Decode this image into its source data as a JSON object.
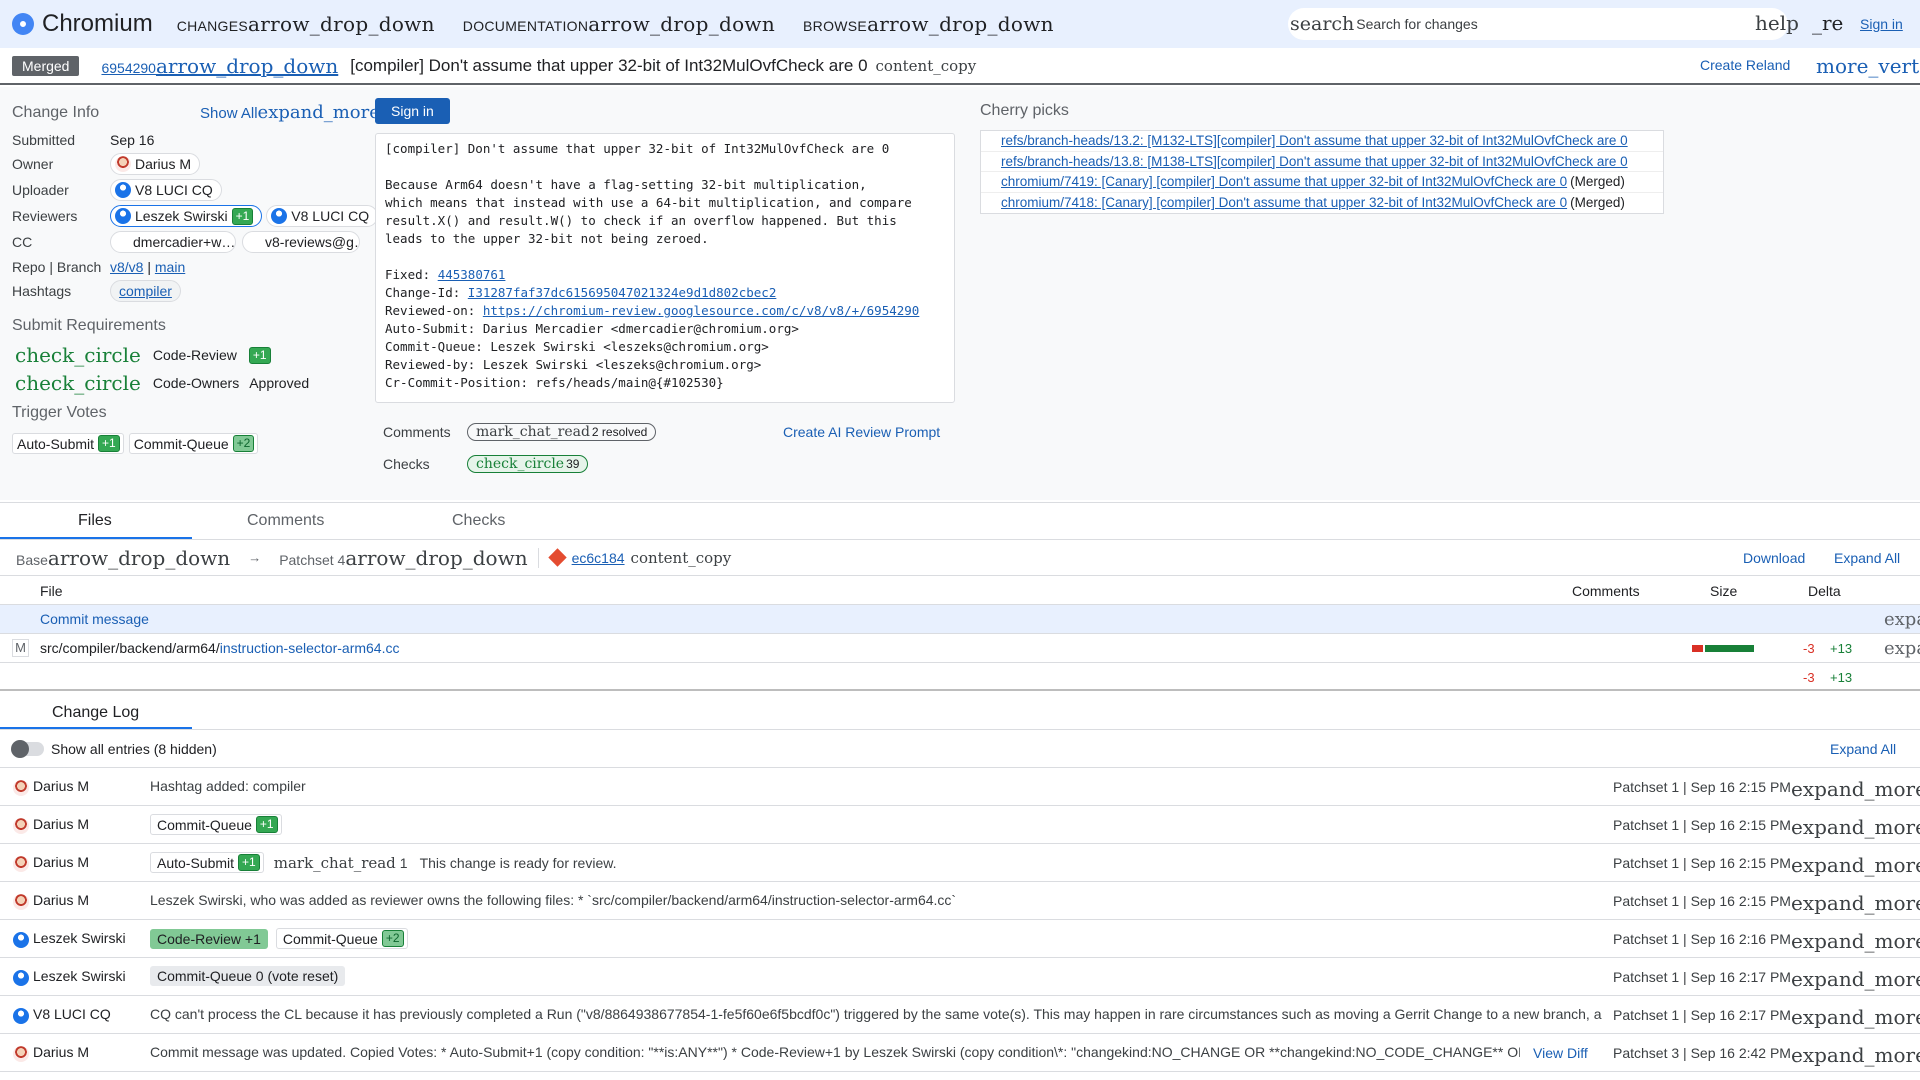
{
  "header": {
    "logo_text": "Chromium",
    "nav": [
      {
        "label": "CHANGES",
        "icon": "arrow_drop_down"
      },
      {
        "label": "DOCUMENTATION",
        "icon": "arrow_drop_down"
      },
      {
        "label": "BROWSE",
        "icon": "arrow_drop_down"
      }
    ],
    "search_icon": "search",
    "search_placeholder": "Search for changes",
    "help_icon": "help",
    "re_icon": "_re",
    "sign_in": "Sign in"
  },
  "change": {
    "status": "Merged",
    "number": "6954290",
    "number_icon": "arrow_drop_down",
    "subject": "[compiler] Don't assume that upper 32-bit of Int32MulOvfCheck are 0",
    "copy_icon": "content_copy",
    "create_reland": "Create Reland",
    "more_icon": "more_vert"
  },
  "info": {
    "title": "Change Info",
    "show_all": "Show All",
    "show_all_icon": "expand_more",
    "sign_in_button": "Sign in",
    "labels": {
      "submitted": "Submitted",
      "owner": "Owner",
      "uploader": "Uploader",
      "reviewers": "Reviewers",
      "cc": "CC",
      "repo_branch": "Repo | Branch",
      "hashtags": "Hashtags"
    },
    "submitted": "Sep 16",
    "owner": "Darius M",
    "uploader": "V8 LUCI CQ",
    "reviewer_1": "Leszek Swirski",
    "reviewer_1_vote": "+1",
    "reviewer_2": "V8 LUCI CQ",
    "cc_1": "dmercadier+w…",
    "cc_2": "v8-reviews@g…",
    "repo": "v8/v8",
    "branch": "main",
    "hashtag": "compiler"
  },
  "submit_requirements": {
    "title": "Submit Requirements",
    "icon": "check_circle",
    "items": [
      {
        "name": "Code-Review",
        "status": "+1"
      },
      {
        "name": "Code-Owners",
        "status": "Approved"
      }
    ]
  },
  "trigger_votes": {
    "title": "Trigger Votes",
    "items": [
      {
        "name": "Auto-Submit",
        "vote": "+1"
      },
      {
        "name": "Commit-Queue",
        "vote": "+2"
      }
    ]
  },
  "commit_message": {
    "subject": "[compiler] Don't assume that upper 32-bit of Int32MulOvfCheck are 0",
    "body": "Because Arm64 doesn't have a flag-setting 32-bit multiplication,\nwhich means that instead with use a 64-bit multiplication, and compare\nresult.X() and result.W() to check if an overflow happened. But this\nleads to the upper 32-bit not being zeroed.",
    "fixed_label": "Fixed: ",
    "fixed": "445380761",
    "change_id_label": "Change-Id: ",
    "change_id": "I31287faf37dc615695047021324e9d1d802cbec2",
    "reviewed_on_label": "Reviewed-on: ",
    "reviewed_on": "https://chromium-review.googlesource.com/c/v8/v8/+/6954290",
    "footer": "Auto-Submit: Darius Mercadier <dmercadier@chromium.org>\nCommit-Queue: Leszek Swirski <leszeks@chromium.org>\nReviewed-by: Leszek Swirski <leszeks@chromium.org>\nCr-Commit-Position: refs/heads/main@{#102530}"
  },
  "summary": {
    "comments_label": "Comments",
    "comments_icon": "mark_chat_read",
    "comments_value": "2 resolved",
    "checks_label": "Checks",
    "checks_icon": "check_circle",
    "checks_value": "39",
    "ai_prompt": "Create AI Review Prompt"
  },
  "cherry_picks": {
    "title": "Cherry picks",
    "items": [
      {
        "link": "refs/branch-heads/13.2: [M132-LTS][compiler] Don't assume that upper 32-bit of Int32MulOvfCheck are 0",
        "status": ""
      },
      {
        "link": "refs/branch-heads/13.8: [M138-LTS][compiler] Don't assume that upper 32-bit of Int32MulOvfCheck are 0",
        "status": ""
      },
      {
        "link": "chromium/7419: [Canary] [compiler] Don't assume that upper 32-bit of Int32MulOvfCheck are 0",
        "status": "(Merged)"
      },
      {
        "link": "chromium/7418: [Canary] [compiler] Don't assume that upper 32-bit of Int32MulOvfCheck are 0",
        "status": "(Merged)"
      }
    ]
  },
  "tabs": [
    "Files",
    "Comments",
    "Checks"
  ],
  "files": {
    "base_label": "Base",
    "patchset_label": "Patchset 4",
    "arrow": "→",
    "dropdown_icon": "arrow_drop_down",
    "commit": "ec6c184",
    "copy_icon": "content_copy",
    "download": "Download",
    "expand_all": "Expand All",
    "columns": [
      "File",
      "Comments",
      "Size",
      "Delta"
    ],
    "commit_message_row": "Commit message",
    "expand_icon": "expa",
    "rows": [
      {
        "status": "M",
        "dir": "src/compiler/backend/arm64/",
        "name": "instruction-selector-arm64.cc",
        "del": "-3",
        "add": "+13",
        "del_count": 3,
        "add_count": 13
      }
    ],
    "total_del": "-3",
    "total_add": "+13"
  },
  "change_log": {
    "title": "Change Log",
    "show_all": "Show all entries (8 hidden)",
    "expand_all": "Expand All",
    "expand_icon": "expand_more",
    "view_diff": "View Diff",
    "entries": [
      {
        "author": "Darius M",
        "message": "Hashtag added: compiler",
        "meta": "Patchset 1 | Sep 16 2:15 PM"
      },
      {
        "author": "Darius M",
        "chip": "Commit-Queue",
        "chip_vote": "+1",
        "meta": "Patchset 1 | Sep 16 2:15 PM"
      },
      {
        "author": "Darius M",
        "chip": "Auto-Submit",
        "chip_vote": "+1",
        "extra_icon": "mark_chat_read",
        "extra_count": "1",
        "message": "This change is ready for review.",
        "meta": "Patchset 1 | Sep 16 2:15 PM"
      },
      {
        "author": "Darius M",
        "message": "Leszek Swirski, who was added as reviewer owns the following files: * `src/compiler/backend/arm64/instruction-selector-arm64.cc`",
        "meta": "Patchset 1 | Sep 16 2:15 PM"
      },
      {
        "author": "Leszek Swirski",
        "chip_a": "Code-Review +1",
        "chip": "Commit-Queue",
        "chip_vote": "+2",
        "meta": "Patchset 1 | Sep 16 2:16 PM"
      },
      {
        "author": "Leszek Swirski",
        "chip_gray": "Commit-Queue 0 (vote reset)",
        "meta": "Patchset 1 | Sep 16 2:17 PM"
      },
      {
        "author": "V8 LUCI CQ",
        "message": "CQ can't process the CL because it has previously completed a Run (\"v8/8864938677854-1-fe5f60e6f5bcdf0c\") triggered by the same vote(s). This may happen in rare circumstances such as moving a Gerrit Change to a new branch, a...",
        "meta": "Patchset 1 | Sep 16 2:17 PM"
      },
      {
        "author": "Darius M",
        "message": "Commit message was updated. Copied Votes: * Auto-Submit+1 (copy condition: \"**is:ANY**\") * Code-Review+1 by Leszek Swirski (copy condition\\*: \"changekind:NO_CHANGE OR **changekind:NO_CODE_CHANGE** OR c...",
        "meta": "Patchset 3 | Sep 16 2:42 PM"
      }
    ]
  },
  "colors": {
    "accent": "#1a73e8",
    "link": "#1a5fb4",
    "approved": "#188038",
    "merged": "#5f6368",
    "header_bg": "#e8f0fe"
  }
}
